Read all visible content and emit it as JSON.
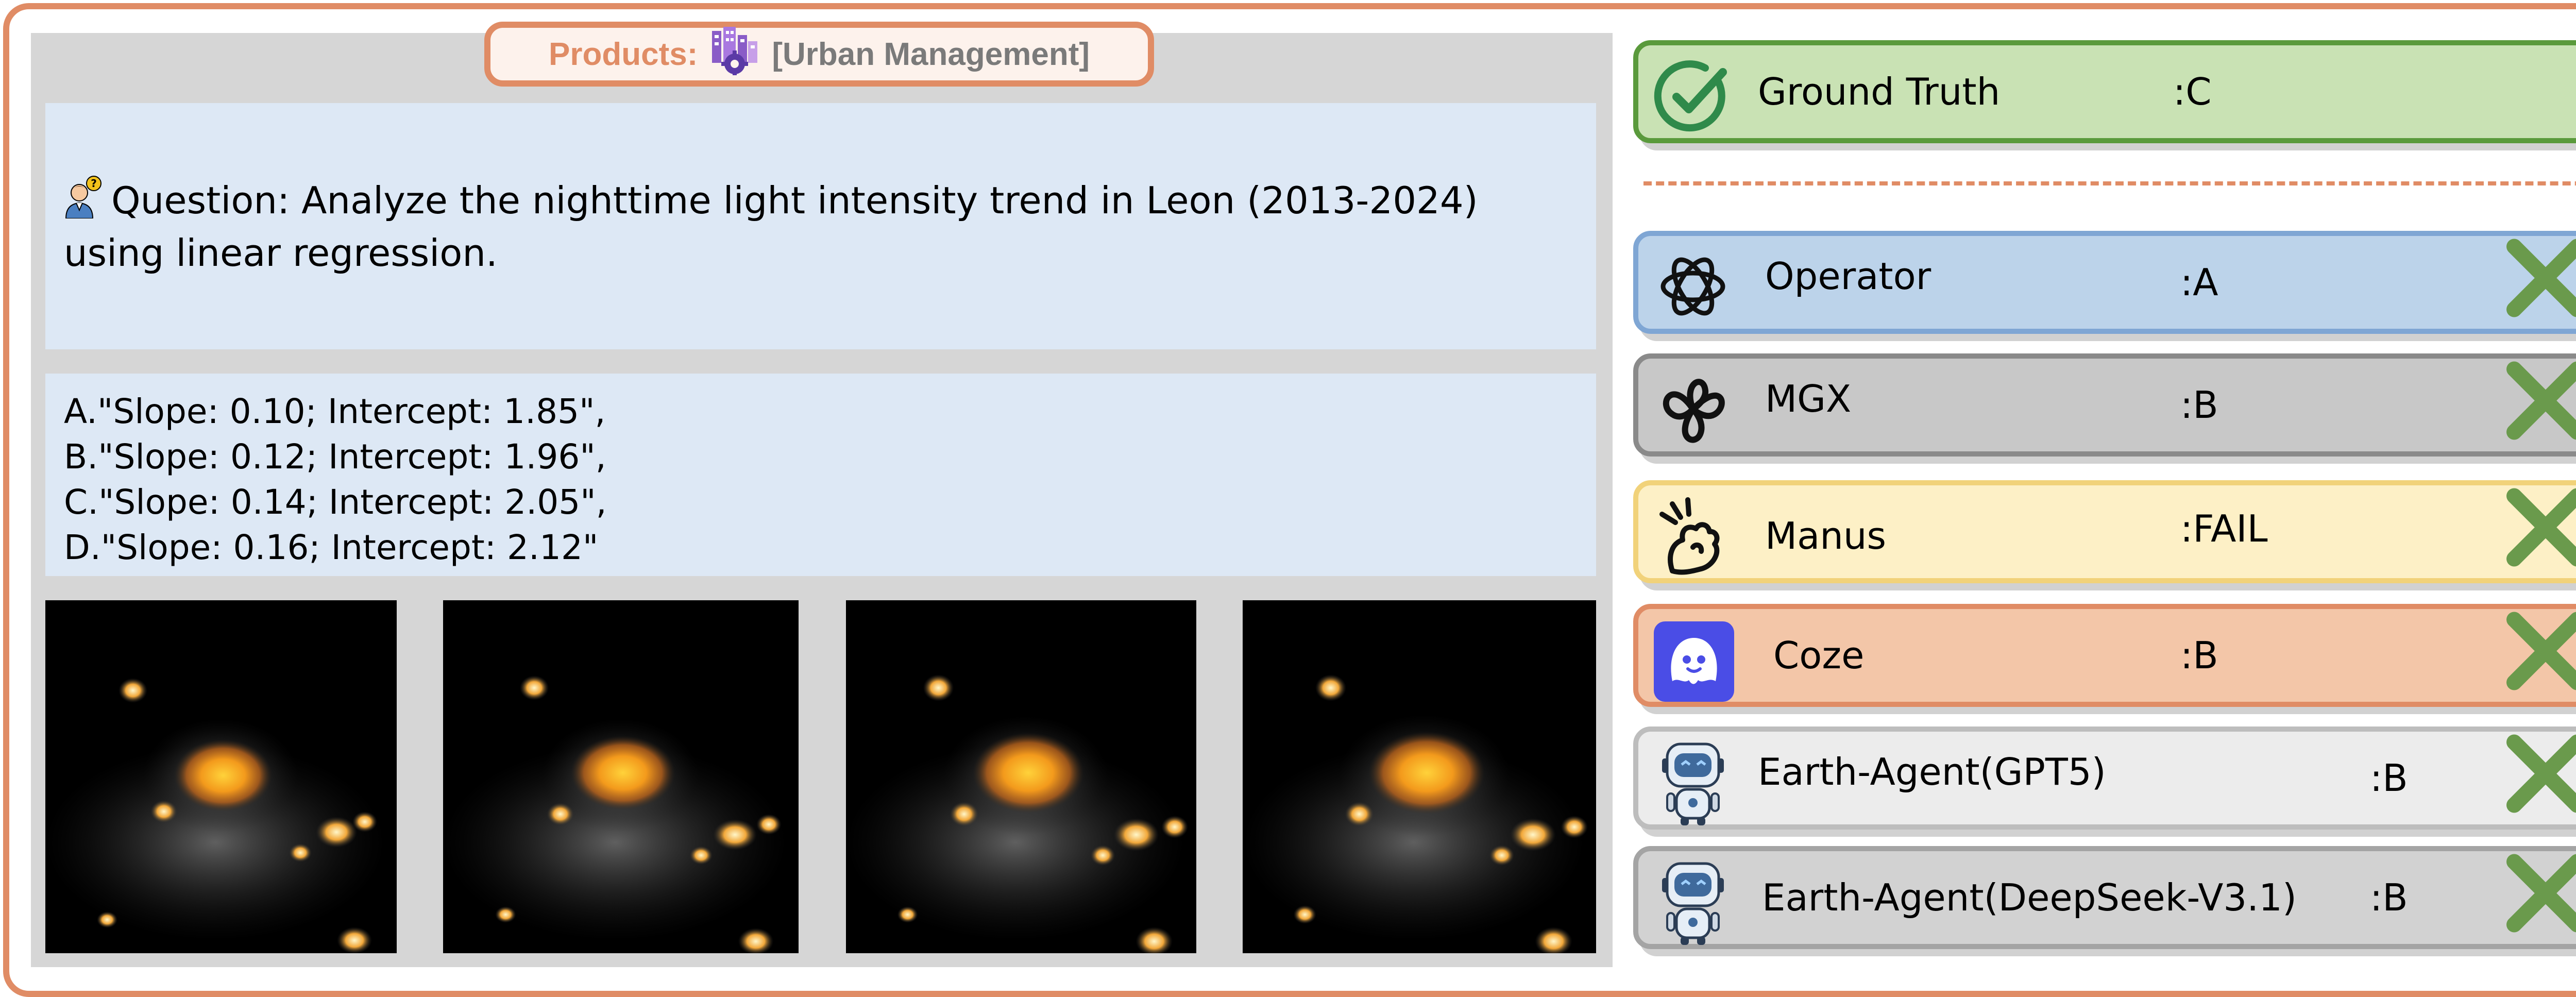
{
  "products": {
    "label": "Products:",
    "value": "[Urban Management]",
    "icon": "city-gear-icon"
  },
  "question": {
    "text": "Question: Analyze the nighttime light intensity trend in Leon (2013-2024) using linear regression."
  },
  "options": [
    "A.\"Slope: 0.10; Intercept: 1.85\",",
    "B.\"Slope: 0.12; Intercept: 1.96\",",
    "C.\"Slope: 0.14; Intercept: 2.05\",",
    "D.\"Slope: 0.16; Intercept: 2.12\""
  ],
  "images": [
    {
      "name": "night-light-image-1"
    },
    {
      "name": "night-light-image-2"
    },
    {
      "name": "night-light-image-3"
    },
    {
      "name": "night-light-image-4"
    }
  ],
  "ground_truth": {
    "label": "Ground Truth",
    "answer": ":C"
  },
  "agents": [
    {
      "name": "Operator",
      "answer": ":A",
      "icon": "openai-icon"
    },
    {
      "name": "MGX",
      "answer": ":B",
      "icon": "mgx-icon"
    },
    {
      "name": "Manus",
      "answer": ":FAIL",
      "icon": "manus-icon"
    },
    {
      "name": "Coze",
      "answer": ":B",
      "icon": "coze-icon"
    },
    {
      "name": "Earth-Agent(GPT5)",
      "answer": ":B",
      "icon": "robot-icon"
    },
    {
      "name": "Earth-Agent(DeepSeek-V3.1)",
      "answer": ":B",
      "icon": "robot-icon"
    }
  ],
  "colors": {
    "accent_orange": "#e08c65",
    "ground_truth_fill": "#c9e2b4",
    "ground_truth_border": "#5a9a3c",
    "wrong_mark": "#6a9a4c"
  }
}
